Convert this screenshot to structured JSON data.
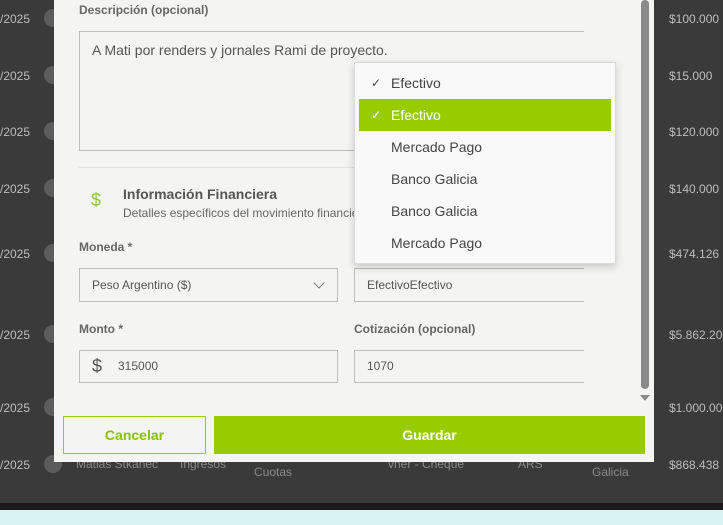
{
  "background": {
    "rows": [
      {
        "date": "/2025",
        "amount": "$100.000"
      },
      {
        "date": "/2025",
        "amount": "$15.000"
      },
      {
        "date": "/2025",
        "amount": "$120.000"
      },
      {
        "date": "/2025",
        "amount": "$140.000"
      },
      {
        "date": "/2025",
        "amount": "$474.126"
      },
      {
        "date": "/2025",
        "amount": "$5.862.200"
      },
      {
        "date": "/2025",
        "amount": "$1.000.000"
      },
      {
        "date": "/2025",
        "amount": "$868.438"
      }
    ],
    "last_row_fragments": {
      "user": "Matias Stkanec",
      "type": "Ingresos",
      "cuotas": "Cuotas",
      "method": "vner - Cheque",
      "currency": "ARS",
      "bank": "Galicia"
    }
  },
  "form": {
    "description_label": "Descripción (opcional)",
    "description_value": "A Mati por renders y jornales Rami de proyecto.",
    "financial_section": {
      "icon": "dollar-icon",
      "title": "Información Financiera",
      "subtitle": "Detalles específicos del movimiento financiero"
    },
    "currency_label": "Moneda *",
    "currency_value": "Peso Argentino ($)",
    "wallet_value": "EfectivoEfectivo",
    "amount_label": "Monto *",
    "amount_prefix": "$",
    "amount_value": "315000",
    "exchange_label": "Cotización (opcional)",
    "exchange_value": "1070"
  },
  "dropdown": {
    "items": [
      {
        "label": "Efectivo",
        "checked": true,
        "highlighted": false
      },
      {
        "label": "Efectivo",
        "checked": true,
        "highlighted": true
      },
      {
        "label": "Mercado Pago",
        "checked": false,
        "highlighted": false
      },
      {
        "label": "Banco Galicia",
        "checked": false,
        "highlighted": false
      },
      {
        "label": "Banco Galicia",
        "checked": false,
        "highlighted": false
      },
      {
        "label": "Mercado Pago",
        "checked": false,
        "highlighted": false
      }
    ],
    "check_glyph": "✓"
  },
  "buttons": {
    "cancel": "Cancelar",
    "save": "Guardar"
  },
  "colors": {
    "accent": "#99cc00",
    "icon_accent": "#8cc63f"
  }
}
